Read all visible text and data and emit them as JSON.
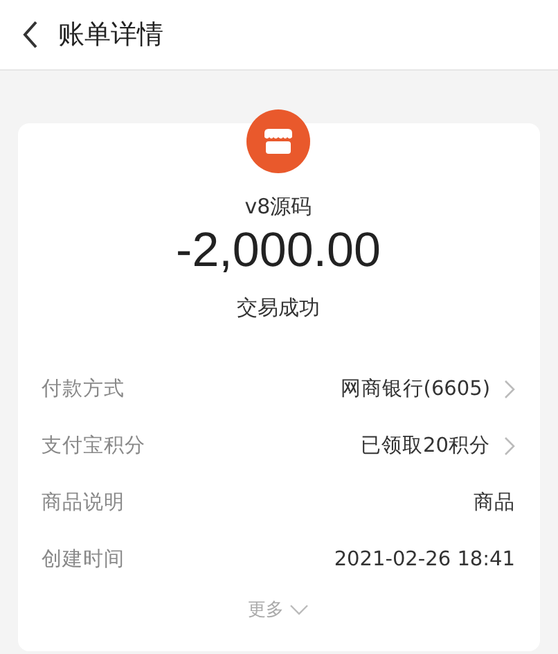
{
  "header": {
    "title": "账单详情"
  },
  "merchant": {
    "name": "v8源码"
  },
  "amount": "-2,000.00",
  "status": "交易成功",
  "details": [
    {
      "label": "付款方式",
      "value": "网商银行(6605)",
      "link": true
    },
    {
      "label": "支付宝积分",
      "value": "已领取20积分",
      "link": true
    },
    {
      "label": "商品说明",
      "value": "商品",
      "link": false
    },
    {
      "label": "创建时间",
      "value": "2021-02-26 18:41",
      "link": false
    }
  ],
  "more": {
    "label": "更多",
    "expanded": false
  }
}
